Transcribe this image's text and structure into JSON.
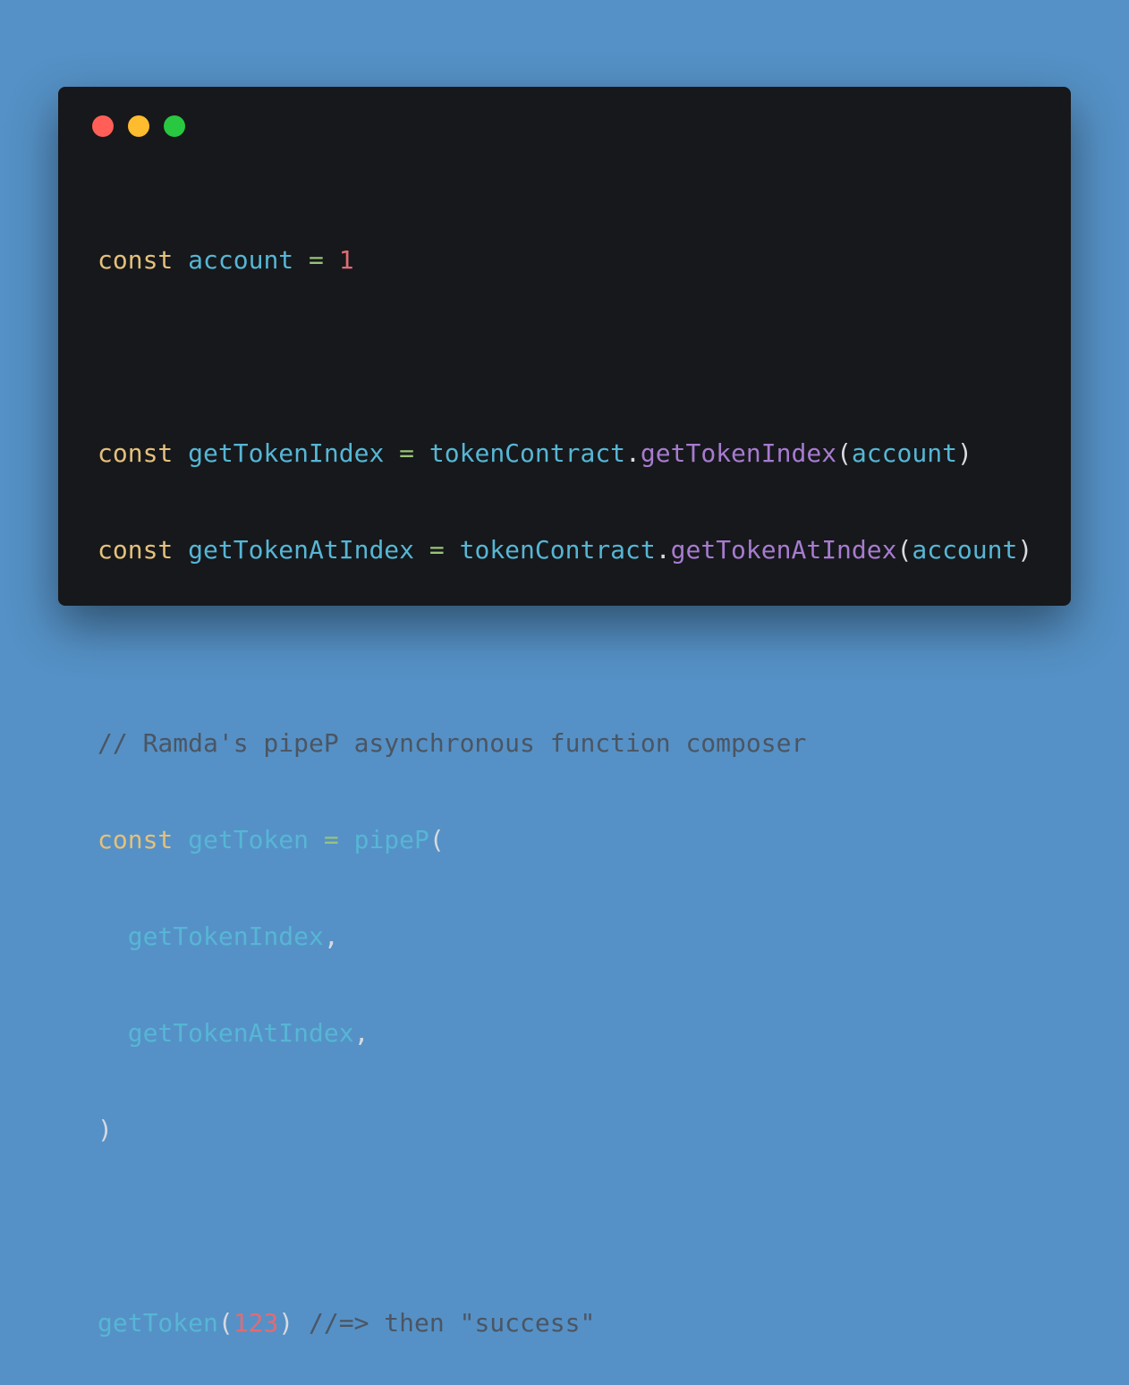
{
  "window": {
    "controls": [
      {
        "name": "close",
        "color": "#ff5f57"
      },
      {
        "name": "minimize",
        "color": "#febc2e"
      },
      {
        "name": "maximize",
        "color": "#28c840"
      }
    ]
  },
  "code": {
    "line1": {
      "kw": "const",
      "name": "account",
      "op": "=",
      "value": "1"
    },
    "line3": {
      "kw": "const",
      "name": "getTokenIndex",
      "op": "=",
      "obj": "tokenContract",
      "dot": ".",
      "method": "getTokenIndex",
      "open": "(",
      "arg": "account",
      "close": ")"
    },
    "line4": {
      "kw": "const",
      "name": "getTokenAtIndex",
      "op": "=",
      "obj": "tokenContract",
      "dot": ".",
      "method": "getTokenAtIndex",
      "open": "(",
      "arg": "account",
      "close": ")"
    },
    "line6": {
      "comment": "// Ramda's pipeP asynchronous function composer"
    },
    "line7": {
      "kw": "const",
      "name": "getToken",
      "op": "=",
      "call": "pipeP",
      "open": "("
    },
    "line8": {
      "arg": "getTokenIndex",
      "comma": ","
    },
    "line9": {
      "arg": "getTokenAtIndex",
      "comma": ","
    },
    "line10": {
      "close": ")"
    },
    "line12": {
      "call": "getToken",
      "open": "(",
      "num": "123",
      "close": ")",
      "comment": "//=> then \"success\""
    }
  }
}
